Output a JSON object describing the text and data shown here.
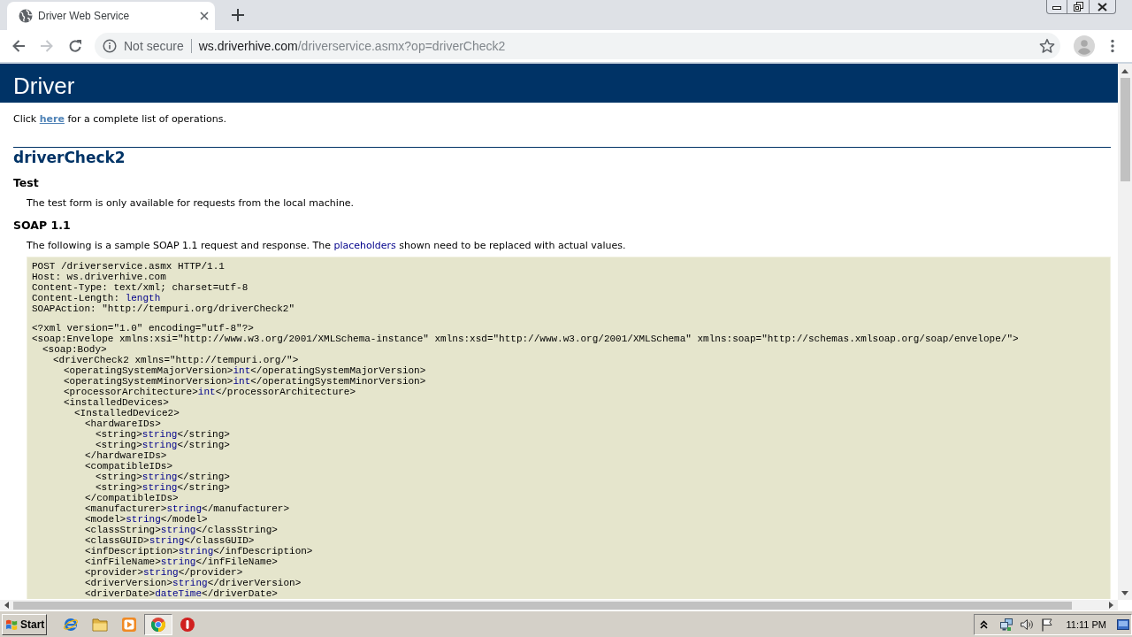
{
  "browser": {
    "tabs": [
      {
        "title": "Driver Web Service",
        "selected": true
      }
    ],
    "nav_buttons": [
      {
        "kind": "back",
        "disabled": false
      },
      {
        "kind": "forward",
        "disabled": true
      },
      {
        "kind": "reload",
        "disabled": false
      }
    ],
    "address_bar": {
      "security_label": "Not secure",
      "host": "ws.driverhive.com",
      "path": "/driverservice.asmx?op=driverCheck2"
    }
  },
  "page": {
    "banner": "Driver",
    "intro": {
      "before": "Click ",
      "link": "here",
      "after": " for a complete list of operations."
    },
    "operation": "driverCheck2",
    "sections": [
      {
        "heading": "Test",
        "paragraph": {
          "text": "The test form is only available for requests from the local machine."
        }
      },
      {
        "heading": "SOAP 1.1",
        "paragraph": {
          "text": "The following is a sample SOAP 1.1 request and response. The ",
          "value": "placeholders",
          "end": " shown need to be replaced with actual values."
        },
        "request": {
          "headers": [
            {
              "text": "POST /driverservice.asmx HTTP/1.1"
            },
            {
              "text": "Host: ws.driverhive.com"
            },
            {
              "text": "Content-Type: text/xml; charset=utf-8"
            },
            {
              "text": "Content-Length: ",
              "value": "length"
            },
            {
              "text": "SOAPAction: \"http://tempuri.org/driverCheck2\""
            }
          ],
          "body": [
            {
              "text": "<?xml version=\"1.0\" encoding=\"utf-8\"?>"
            },
            {
              "text": "<soap:Envelope xmlns:xsi=\"http://www.w3.org/2001/XMLSchema-instance\" xmlns:xsd=\"http://www.w3.org/2001/XMLSchema\" xmlns:soap=\"http://schemas.xmlsoap.org/soap/envelope/\">",
              "children": [
                {
                  "text": "<soap:Body>",
                  "children": [
                    {
                      "text": "<driverCheck2 xmlns=\"http://tempuri.org/\">",
                      "children": [
                        {
                          "text": "<operatingSystemMajorVersion>",
                          "value": "int",
                          "end": "</operatingSystemMajorVersion>"
                        },
                        {
                          "text": "<operatingSystemMinorVersion>",
                          "value": "int",
                          "end": "</operatingSystemMinorVersion>"
                        },
                        {
                          "text": "<processorArchitecture>",
                          "value": "int",
                          "end": "</processorArchitecture>"
                        },
                        {
                          "text": "<installedDevices>",
                          "children": [
                            {
                              "text": "<InstalledDevice2>",
                              "children": [
                                {
                                  "text": "<hardwareIDs>",
                                  "children": [
                                    {
                                      "text": "<string>",
                                      "value": "string",
                                      "end": "</string>"
                                    },
                                    {
                                      "text": "<string>",
                                      "value": "string",
                                      "end": "</string>"
                                    }
                                  ]
                                },
                                {
                                  "text": "</hardwareIDs>"
                                },
                                {
                                  "text": "<compatibleIDs>",
                                  "children": [
                                    {
                                      "text": "<string>",
                                      "value": "string",
                                      "end": "</string>"
                                    },
                                    {
                                      "text": "<string>",
                                      "value": "string",
                                      "end": "</string>"
                                    }
                                  ]
                                },
                                {
                                  "text": "</compatibleIDs>"
                                },
                                {
                                  "text": "<manufacturer>",
                                  "value": "string",
                                  "end": "</manufacturer>"
                                },
                                {
                                  "text": "<model>",
                                  "value": "string",
                                  "end": "</model>"
                                },
                                {
                                  "text": "<classString>",
                                  "value": "string",
                                  "end": "</classString>"
                                },
                                {
                                  "text": "<classGUID>",
                                  "value": "string",
                                  "end": "</classGUID>"
                                },
                                {
                                  "text": "<infDescription>",
                                  "value": "string",
                                  "end": "</infDescription>"
                                },
                                {
                                  "text": "<infFileName>",
                                  "value": "string",
                                  "end": "</infFileName>"
                                },
                                {
                                  "text": "<provider>",
                                  "value": "string",
                                  "end": "</provider>"
                                },
                                {
                                  "text": "<driverVersion>",
                                  "value": "string",
                                  "end": "</driverVersion>"
                                },
                                {
                                  "text": "<driverDate>",
                                  "value": "dateTime",
                                  "end": "</driverDate>"
                                }
                              ]
                            }
                          ]
                        }
                      ]
                    }
                  ]
                }
              ]
            }
          ]
        }
      }
    ]
  },
  "taskbar": {
    "start": "Start",
    "apps": [
      {
        "kind": "e-logo",
        "selected": false
      },
      {
        "kind": "folder",
        "selected": false
      },
      {
        "kind": "player",
        "selected": false
      },
      {
        "kind": "circle-logo",
        "selected": true
      },
      {
        "kind": "alert",
        "selected": false
      }
    ],
    "clock": "11:11 PM"
  }
}
